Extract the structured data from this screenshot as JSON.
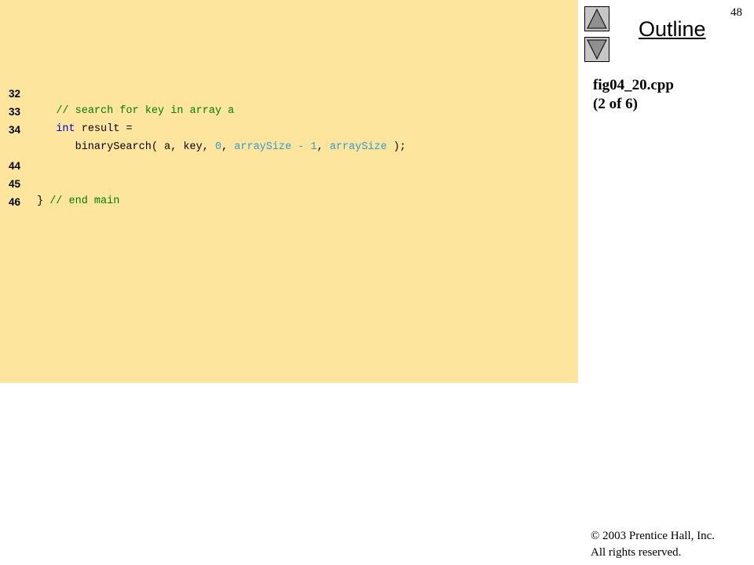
{
  "slide": {
    "number": "48",
    "outline_title": "Outline",
    "file_name": "fig04_20.cpp",
    "part_label": "(2 of 6)",
    "copyright_symbol": "©",
    "copyright_year_publisher": "2003 Prentice Hall, Inc.",
    "rights": "All rights reserved."
  },
  "navigation": {
    "up_icon": "triangle-up-icon",
    "down_icon": "triangle-down-icon"
  },
  "code": {
    "background_color": "#fee59d",
    "colors": {
      "comment": "#008000",
      "keyword": "#0000cc",
      "literal": "#3399cc"
    },
    "lines": [
      {
        "number": "32",
        "indent": "   ",
        "tokens": [
          {
            "text": "// search for key in array a",
            "kind": "comment"
          }
        ]
      },
      {
        "number": "33",
        "indent": "   ",
        "tokens": [
          {
            "text": "int",
            "kind": "keyword"
          },
          {
            "text": " result =",
            "kind": "plain"
          }
        ]
      },
      {
        "number": "34",
        "indent": "      ",
        "tokens": [
          {
            "text": "binarySearch( a, key, ",
            "kind": "plain"
          },
          {
            "text": "0",
            "kind": "literal"
          },
          {
            "text": ", ",
            "kind": "plain"
          },
          {
            "text": "arraySize - 1",
            "kind": "literal"
          },
          {
            "text": ", ",
            "kind": "plain"
          },
          {
            "text": "arraySize",
            "kind": "literal"
          },
          {
            "text": " );",
            "kind": "plain"
          }
        ]
      },
      {
        "number": "44",
        "indent": "",
        "tokens": []
      },
      {
        "number": "45",
        "indent": "",
        "tokens": [
          {
            "text": "} ",
            "kind": "plain"
          },
          {
            "text": "// end main",
            "kind": "comment"
          }
        ]
      },
      {
        "number": "46",
        "indent": "",
        "tokens": []
      }
    ]
  }
}
